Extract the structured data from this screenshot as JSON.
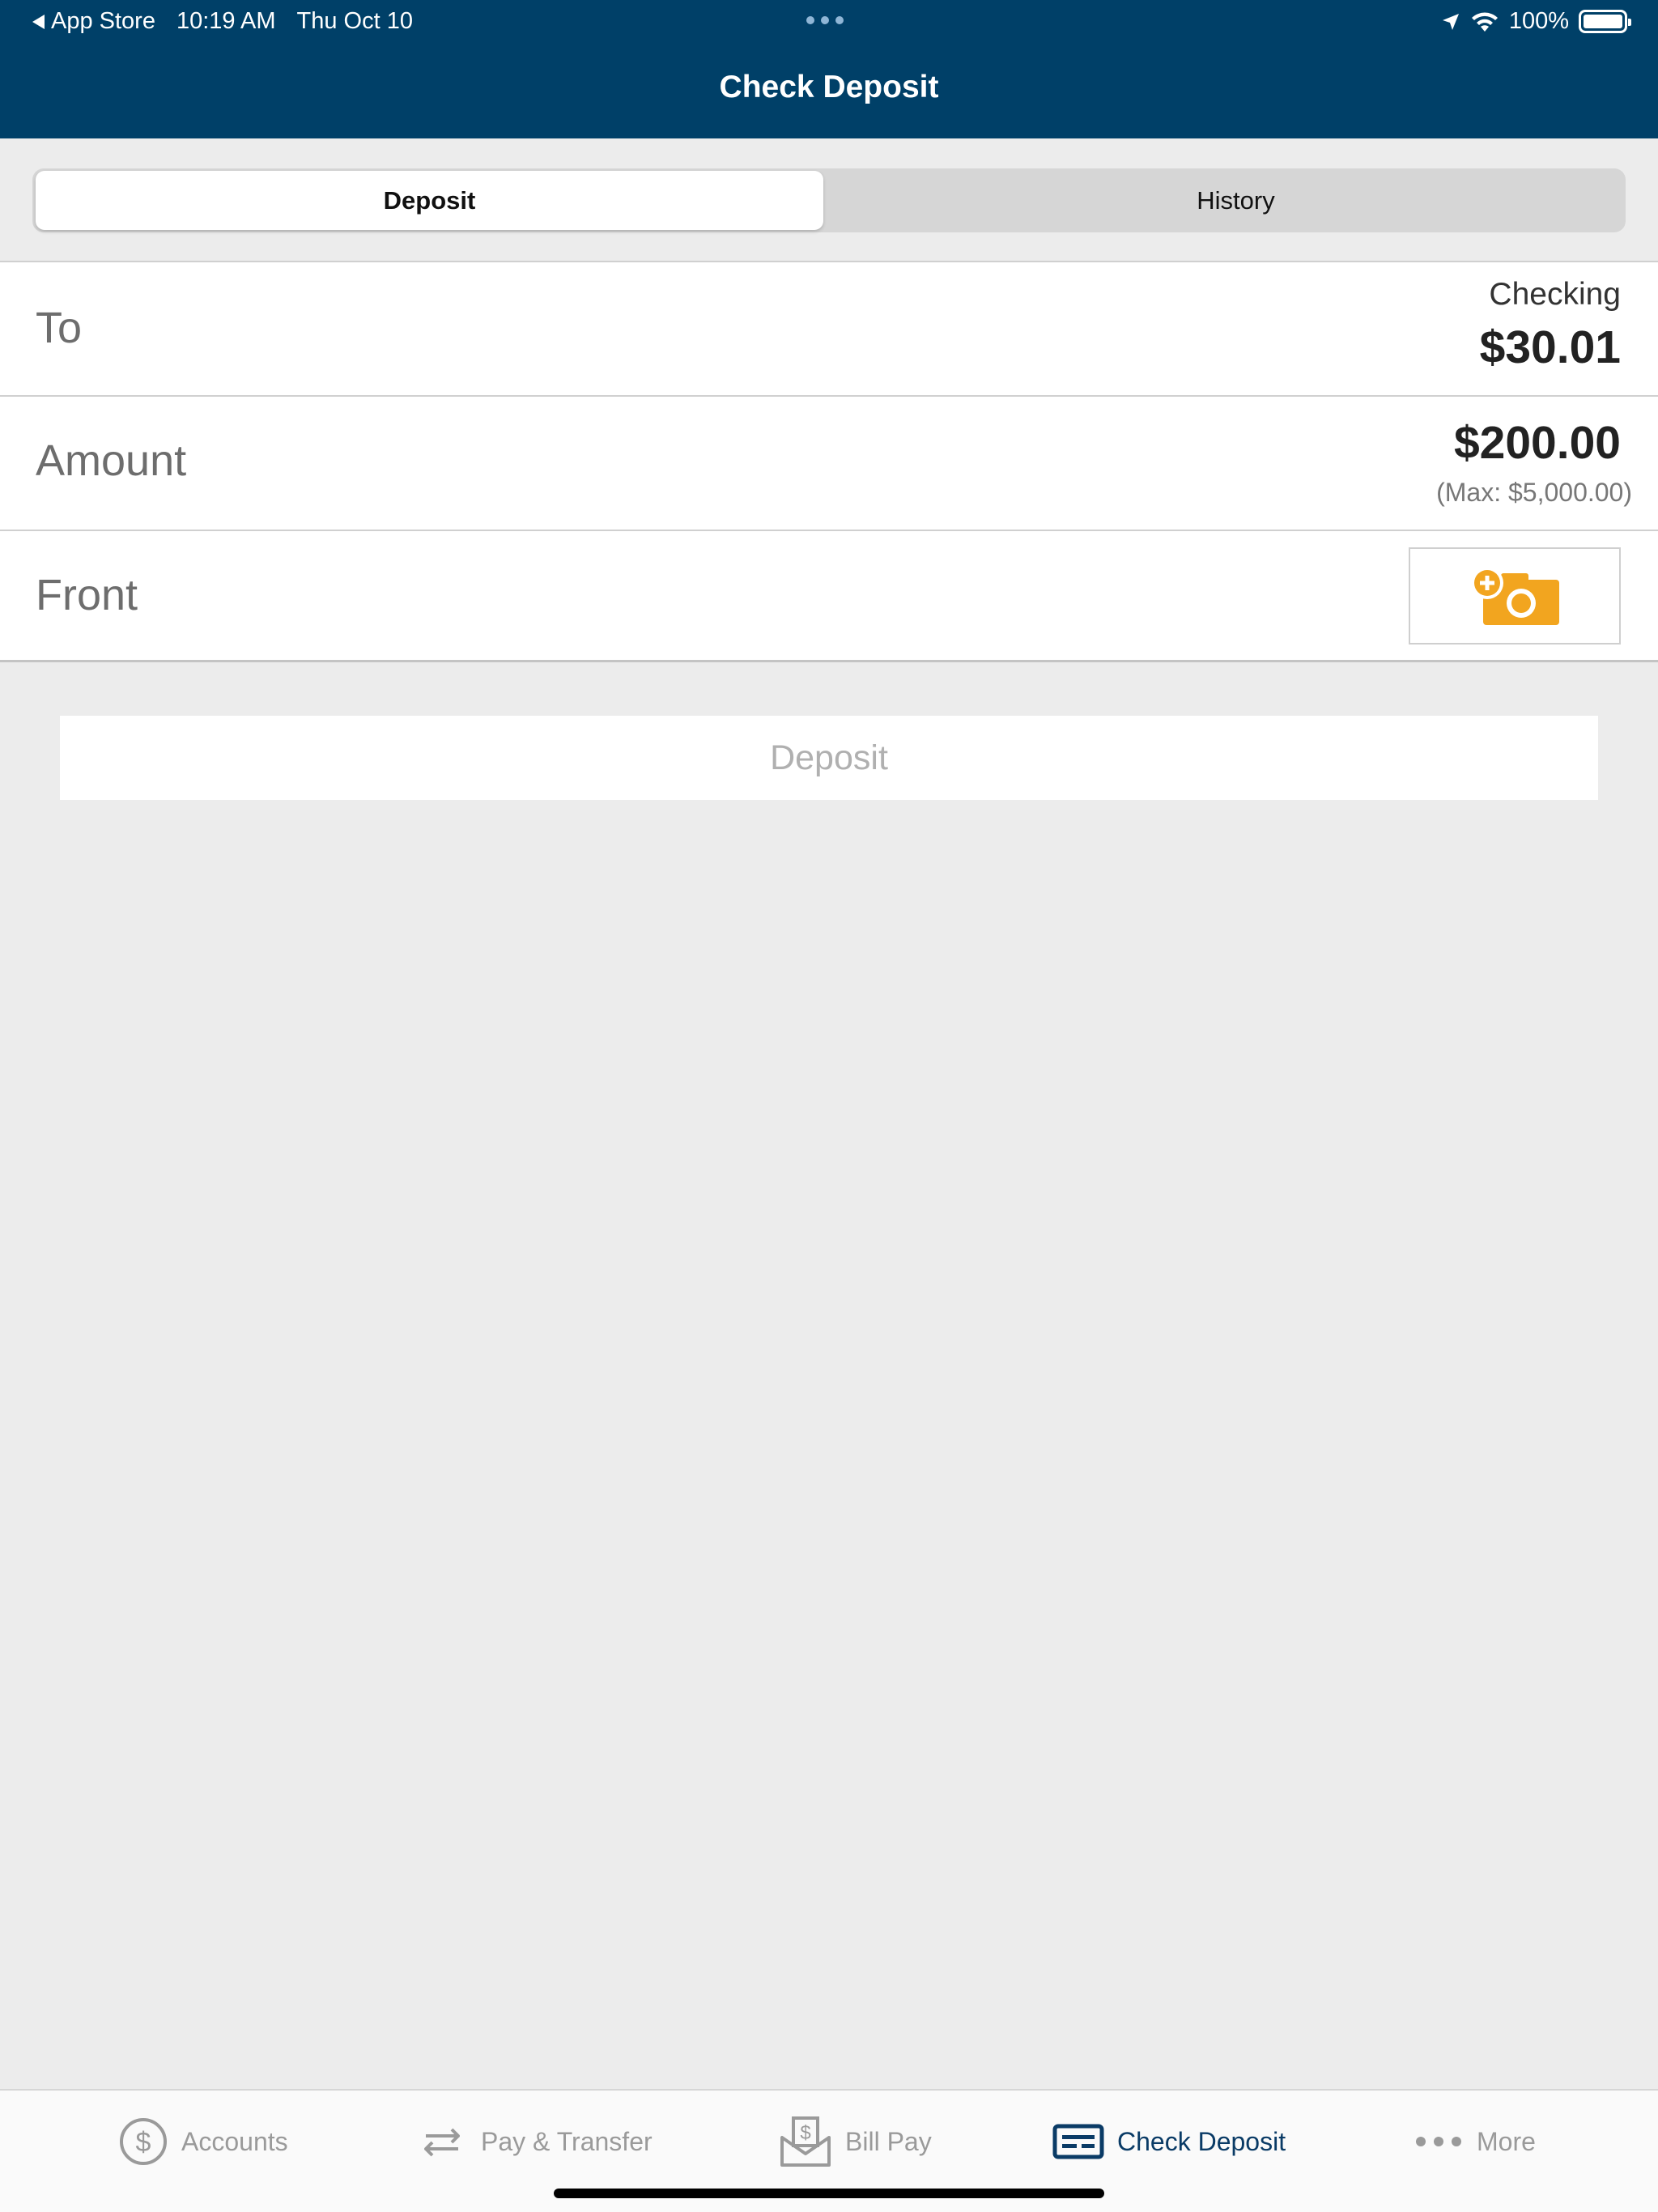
{
  "status_bar": {
    "back_app": "App Store",
    "time": "10:19 AM",
    "date": "Thu Oct 10",
    "battery": "100%"
  },
  "header": {
    "title": "Check Deposit"
  },
  "segments": {
    "deposit": "Deposit",
    "history": "History",
    "selected": "deposit"
  },
  "form": {
    "to": {
      "label": "To",
      "account": "Checking",
      "balance": "$30.01"
    },
    "amount": {
      "label": "Amount",
      "value": "$200.00",
      "max": "(Max: $5,000.00)"
    },
    "front": {
      "label": "Front",
      "icon": "add-camera-icon"
    }
  },
  "deposit_button": {
    "label": "Deposit",
    "enabled": false
  },
  "tabbar": {
    "items": [
      {
        "label": "Accounts",
        "icon": "dollar-circle-icon"
      },
      {
        "label": "Pay & Transfer",
        "icon": "transfer-arrows-icon"
      },
      {
        "label": "Bill Pay",
        "icon": "bill-envelope-icon"
      },
      {
        "label": "Check Deposit",
        "icon": "check-card-icon",
        "active": true
      },
      {
        "label": "More",
        "icon": "more-dots-icon"
      }
    ]
  },
  "colors": {
    "header": "#004068",
    "accent_orange": "#f2a51f",
    "active_tab": "#0a3b66",
    "background": "#ececec"
  }
}
